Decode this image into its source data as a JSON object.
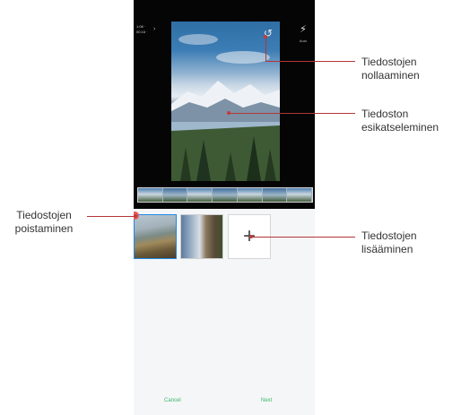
{
  "toolbar": {
    "meta_line_1": "1:08 ·",
    "meta_line_2": "00:16 ·",
    "chevron": "›",
    "reset_icon": "↺",
    "wand_icon": "⚡",
    "wand_label": "Auto"
  },
  "thumbnails": {
    "add_symbol": "+"
  },
  "footer": {
    "cancel_label": "Cancel",
    "next_label": "Next"
  },
  "callouts": {
    "reset": "Tiedostojen nollaaminen",
    "preview": "Tiedoston esikatseleminen",
    "delete": "Tiedostojen poistaminen",
    "add": "Tiedostojen lisääminen"
  },
  "colors": {
    "callout_line": "#b33636",
    "accent_blue": "#1e88e5",
    "action_green": "#3ab76b",
    "delete_red": "#e45b5b"
  }
}
